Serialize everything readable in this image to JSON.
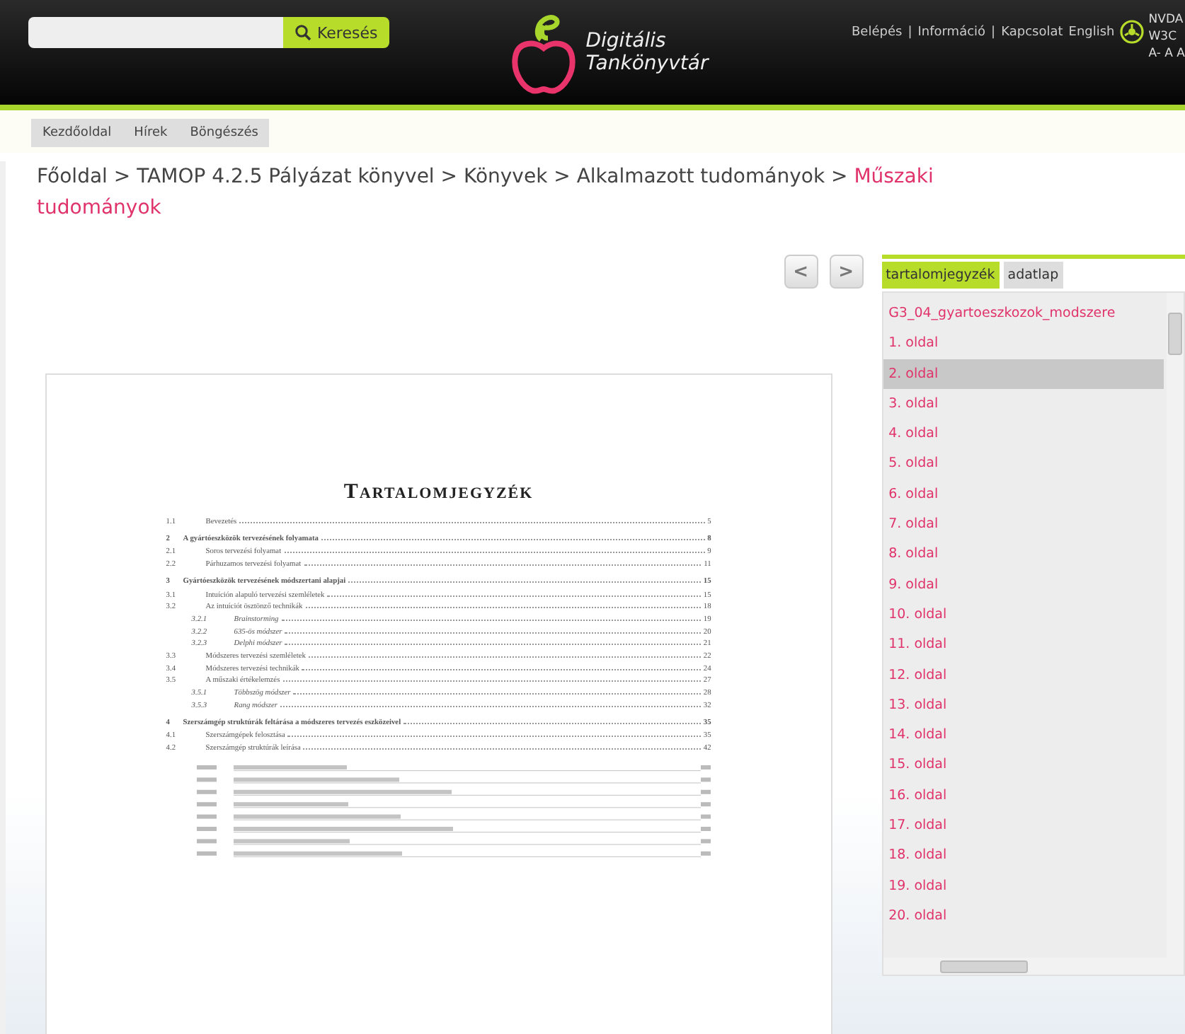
{
  "header": {
    "search": {
      "button": "Keresés"
    },
    "logo": {
      "line1": "Digitális",
      "line2": "Tankönyvtár"
    },
    "links": [
      "Belépés",
      "Információ",
      "Kapcsolat"
    ],
    "separator": "|",
    "language": "English",
    "accessibility": [
      "NVDA",
      "W3C",
      "A- A A"
    ]
  },
  "nav": [
    "Kezdőoldal",
    "Hírek",
    "Böngészés"
  ],
  "breadcrumb": {
    "items": [
      "Főoldal",
      "TAMOP 4.2.5 Pályázat könyvel",
      "Könyvek",
      "Alkalmazott tudományok"
    ],
    "current": "Műszaki tudományok",
    "separator": ">"
  },
  "pager": {
    "prev": "<",
    "next": ">"
  },
  "document": {
    "title": "Tartalomjegyzék",
    "entries": [
      {
        "num": "1.1",
        "text": "Bevezetés",
        "page": "5",
        "kind": "section"
      },
      {
        "num": "2",
        "text": "A gyártóeszközök tervezésének folyamata",
        "page": "8",
        "kind": "chapter"
      },
      {
        "num": "2.1",
        "text": "Soros tervezési folyamat",
        "page": "9",
        "kind": "section"
      },
      {
        "num": "2.2",
        "text": "Párhuzamos tervezési folyamat",
        "page": "11",
        "kind": "section"
      },
      {
        "num": "3",
        "text": "Gyártóeszközök tervezésének módszertani alapjai",
        "page": "15",
        "kind": "chapter"
      },
      {
        "num": "3.1",
        "text": "Intuíción alapuló tervezési szemléletek",
        "page": "15",
        "kind": "section"
      },
      {
        "num": "3.2",
        "text": "Az intuíciót ösztönző technikák",
        "page": "18",
        "kind": "section"
      },
      {
        "num": "3.2.1",
        "text": "Brainstorming",
        "page": "19",
        "kind": "sub"
      },
      {
        "num": "3.2.2",
        "text": "635-ös módszer",
        "page": "20",
        "kind": "sub"
      },
      {
        "num": "3.2.3",
        "text": "Delphi módszer",
        "page": "21",
        "kind": "sub"
      },
      {
        "num": "3.3",
        "text": "Módszeres tervezési szemléletek",
        "page": "22",
        "kind": "section"
      },
      {
        "num": "3.4",
        "text": "Módszeres tervezési technikák",
        "page": "24",
        "kind": "section"
      },
      {
        "num": "3.5",
        "text": "A műszaki értékelemzés",
        "page": "27",
        "kind": "section"
      },
      {
        "num": "3.5.1",
        "text": "Többszög módszer",
        "page": "28",
        "kind": "sub"
      },
      {
        "num": "3.5.3",
        "text": "Rang módszer",
        "page": "32",
        "kind": "sub"
      },
      {
        "num": "4",
        "text": "Szerszámgép struktúrák feltárása a módszeres tervezés eszközeivel",
        "page": "35",
        "kind": "chapter"
      },
      {
        "num": "4.1",
        "text": "Szerszámgépek felosztása",
        "page": "35",
        "kind": "section"
      },
      {
        "num": "4.2",
        "text": "Szerszámgép struktúrák leírása",
        "page": "42",
        "kind": "section"
      }
    ]
  },
  "sidebar": {
    "tabs": [
      {
        "label": "tartalomjegyzék",
        "selected": true
      },
      {
        "label": "adatlap",
        "selected": false
      }
    ],
    "items": [
      {
        "label": "G3_04_gyartoeszkozok_modszere",
        "selected": false
      },
      {
        "label": "1. oldal",
        "selected": false
      },
      {
        "label": "2. oldal",
        "selected": true
      },
      {
        "label": "3. oldal",
        "selected": false
      },
      {
        "label": "4. oldal",
        "selected": false
      },
      {
        "label": "5. oldal",
        "selected": false
      },
      {
        "label": "6. oldal",
        "selected": false
      },
      {
        "label": "7. oldal",
        "selected": false
      },
      {
        "label": "8. oldal",
        "selected": false
      },
      {
        "label": "9. oldal",
        "selected": false
      },
      {
        "label": "10. oldal",
        "selected": false
      },
      {
        "label": "11. oldal",
        "selected": false
      },
      {
        "label": "12. oldal",
        "selected": false
      },
      {
        "label": "13. oldal",
        "selected": false
      },
      {
        "label": "14. oldal",
        "selected": false
      },
      {
        "label": "15. oldal",
        "selected": false
      },
      {
        "label": "16. oldal",
        "selected": false
      },
      {
        "label": "17. oldal",
        "selected": false
      },
      {
        "label": "18. oldal",
        "selected": false
      },
      {
        "label": "19. oldal",
        "selected": false
      },
      {
        "label": "20. oldal",
        "selected": false
      }
    ]
  }
}
